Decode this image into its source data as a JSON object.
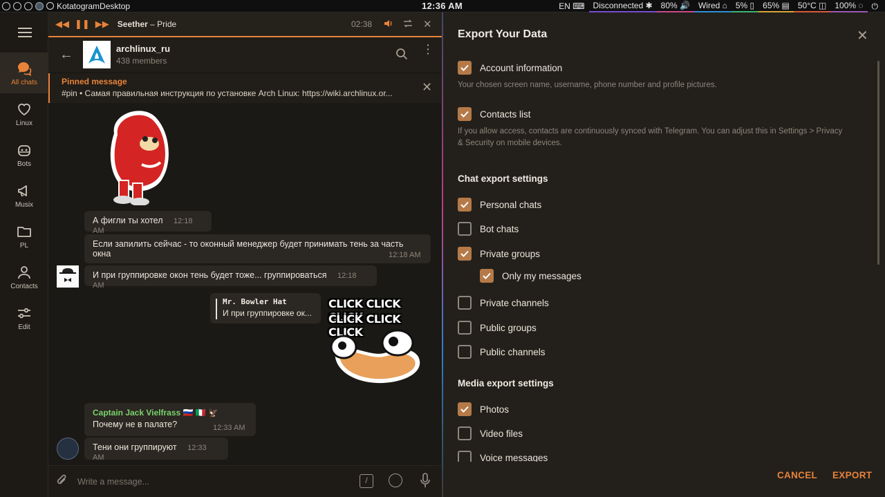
{
  "topbar": {
    "app_title": "KotatogramDesktop",
    "clock": "12:36 AM",
    "tray": [
      {
        "label": "EN ⌨"
      },
      {
        "label": "Disconnected ✱"
      },
      {
        "label": "80% 🔊"
      },
      {
        "label": "Wired ⌂"
      },
      {
        "label": "5% ▯"
      },
      {
        "label": "65% ▤"
      },
      {
        "label": "50°C ◫"
      },
      {
        "label": "100% ◌"
      },
      {
        "label": "⏻"
      }
    ]
  },
  "folders": [
    {
      "label": "All chats",
      "icon": "chats-icon"
    },
    {
      "label": "Linux",
      "icon": "heart-icon"
    },
    {
      "label": "Bots",
      "icon": "bot-icon"
    },
    {
      "label": "Musix",
      "icon": "megaphone-icon"
    },
    {
      "label": "PL",
      "icon": "folder-icon"
    },
    {
      "label": "Contacts",
      "icon": "person-icon"
    },
    {
      "label": "Edit",
      "icon": "sliders-icon"
    }
  ],
  "player": {
    "artist": "Seether",
    "separator": " – ",
    "song": "Pride",
    "time": "02:38"
  },
  "chat": {
    "name": "archlinux_ru",
    "members": "438 members",
    "pinned_title": "Pinned message",
    "pinned_text": "#pin • Самая правильная инструкция по установке Arch Linux: https://wiki.archlinux.or...",
    "messages": [
      {
        "text": "А фигли ты хотел",
        "time": "12:18 AM"
      },
      {
        "text": "Если запилить сейчас - то оконный менеджер будет принимать тень за часть окна",
        "time": "12:18 AM"
      },
      {
        "text": "И при группировке окон тень будет тоже... группироваться",
        "time": "12:18 AM"
      },
      {
        "reply_name": "Mr. Bowler Hat",
        "reply_text": "И при группировке ок..."
      },
      {
        "sender": "Captain Jack Vielfrass 🇷🇺 🇮🇹 🦅",
        "text": "Почему не в палате?",
        "time": "12:33 AM"
      },
      {
        "text": "Тени они группируют",
        "time": "12:33 AM"
      }
    ],
    "sticker_text": [
      "CLICK CLICK CLICK",
      "CLICK CLICK CLICK"
    ],
    "composer_placeholder": "Write a message..."
  },
  "export": {
    "title": "Export Your Data",
    "account_info": {
      "label": "Account information",
      "checked": true,
      "desc": "Your chosen screen name, username, phone number and profile pictures."
    },
    "contacts": {
      "label": "Contacts list",
      "checked": true,
      "desc_1": "If you allow access, contacts are continuously synced with Telegram. You can adjust this in Settings > Privacy",
      "desc_2": "& Security on mobile devices."
    },
    "chat_section": "Chat export settings",
    "chat_options": [
      {
        "label": "Personal chats",
        "checked": true
      },
      {
        "label": "Bot chats",
        "checked": false
      },
      {
        "label": "Private groups",
        "checked": true
      },
      {
        "label": "Only my messages",
        "checked": true
      },
      {
        "label": "Private channels",
        "checked": false
      },
      {
        "label": "Public groups",
        "checked": false
      },
      {
        "label": "Public channels",
        "checked": false
      }
    ],
    "media_section": "Media export settings",
    "media_options": [
      {
        "label": "Photos",
        "checked": true
      },
      {
        "label": "Video files",
        "checked": false
      },
      {
        "label": "Voice messages",
        "checked": false
      }
    ],
    "cancel": "CANCEL",
    "export": "EXPORT"
  },
  "colors": {
    "accent": "#e8833a",
    "checkbox_checked": "#b57a48",
    "sender_green": "#7ad36b"
  }
}
